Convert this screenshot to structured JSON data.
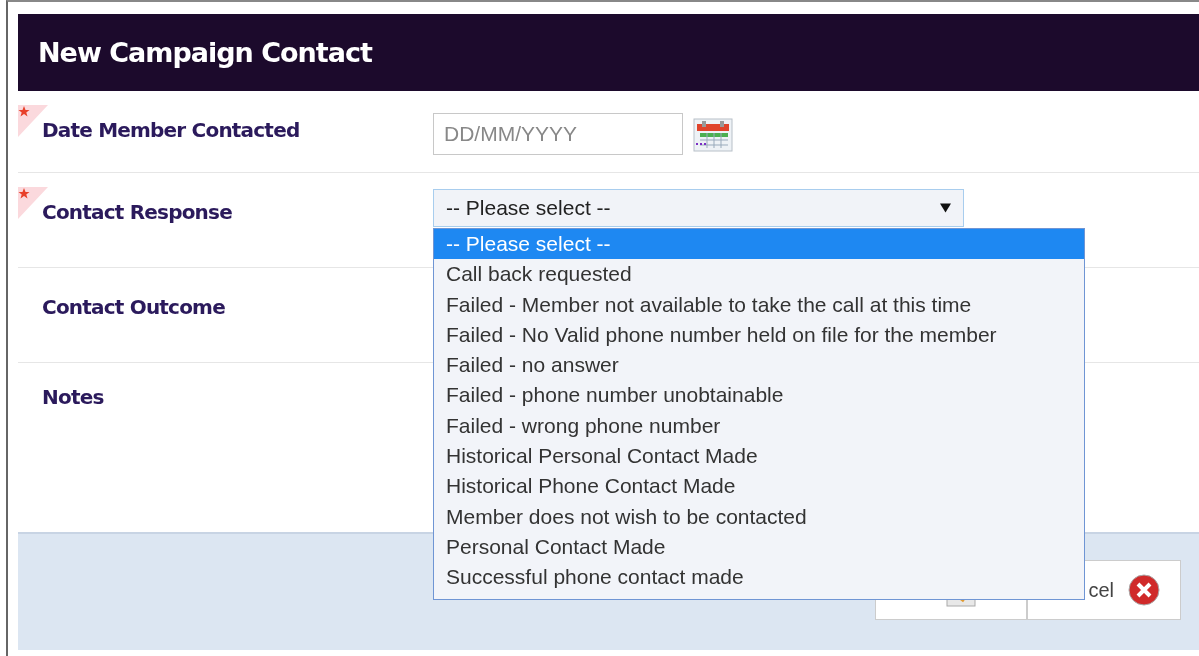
{
  "dialog": {
    "title": "New Campaign Contact"
  },
  "fields": [
    {
      "kind": "date",
      "label": "Date Member Contacted",
      "required": true,
      "placeholder": "DD/MM/YYYY"
    },
    {
      "kind": "select",
      "label": "Contact Response",
      "required": true,
      "value": "-- Please select --",
      "expanded": true,
      "options": [
        {
          "label": "-- Please select --",
          "selected": true
        },
        {
          "label": "Call back requested",
          "selected": false
        },
        {
          "label": "Failed - Member not available to take the call at this time",
          "selected": false
        },
        {
          "label": "Failed - No Valid phone number held on file for the member",
          "selected": false
        },
        {
          "label": "Failed - no answer",
          "selected": false
        },
        {
          "label": "Failed - phone number unobtainable",
          "selected": false
        },
        {
          "label": "Failed - wrong phone number",
          "selected": false
        },
        {
          "label": "Historical Personal Contact Made",
          "selected": false
        },
        {
          "label": "Historical Phone Contact Made",
          "selected": false
        },
        {
          "label": "Member does not wish to be contacted",
          "selected": false
        },
        {
          "label": "Personal Contact Made",
          "selected": false
        },
        {
          "label": "Successful phone contact made",
          "selected": false
        }
      ]
    },
    {
      "kind": "plain",
      "label": "Contact Outcome",
      "required": false
    },
    {
      "kind": "notes",
      "label": "Notes",
      "required": false
    }
  ],
  "buttons": [
    {
      "kind": "save"
    },
    {
      "kind": "cancel",
      "label": "cel"
    }
  ]
}
